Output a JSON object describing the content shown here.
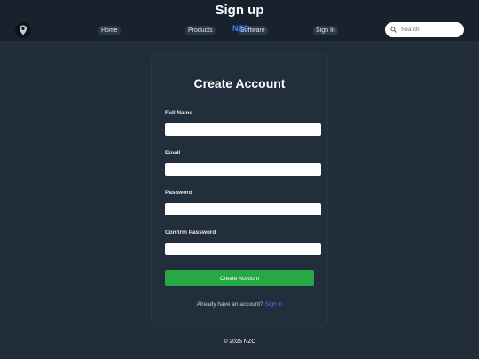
{
  "header": {
    "title": "Sign up",
    "brand": "NZC",
    "nav": {
      "home": "Home",
      "products": "Products",
      "software": "Software"
    },
    "signin": "Sign In",
    "search": {
      "placeholder": "Search"
    },
    "logo_icon": "map-pin-icon"
  },
  "form": {
    "title": "Create Account",
    "full_name_label": "Full Name",
    "email_label": "Email",
    "password_label": "Password",
    "confirm_password_label": "Confirm Password",
    "submit_label": "Create Account",
    "already_text": "Already have an account?",
    "signin_link": "Sign in"
  },
  "footer": {
    "text": "© 2025 NZC"
  },
  "colors": {
    "background": "#222d3b",
    "header": "#18222f",
    "accent": "#3b82f6",
    "submit": "#28a745"
  }
}
